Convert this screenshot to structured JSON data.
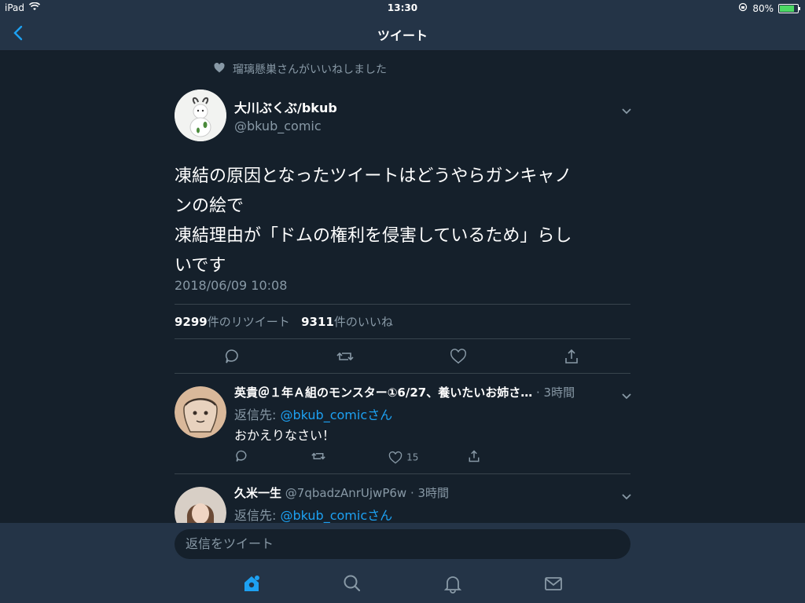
{
  "status_bar": {
    "device": "iPad",
    "time": "13:30",
    "battery": "80%"
  },
  "nav": {
    "title": "ツイート"
  },
  "context": {
    "text": "瑠璃懸巣さんがいいねしました"
  },
  "tweet": {
    "author_name": "大川ぶくぶ/bkub",
    "author_handle": "@bkub_comic",
    "lines": [
      "凍結の原因となったツイートはどうやらガンキャノ",
      "ンの絵で",
      "凍結理由が「ドムの権利を侵害しているため」らし",
      "いです"
    ],
    "timestamp": "2018/06/09 10:08",
    "retweet_count": "9299",
    "retweet_label": "件のリツイート",
    "like_count": "9311",
    "like_label": "件のいいね"
  },
  "replies": [
    {
      "name": "英貴＠１年Ａ組のモンスター①6/27、養いたいお姉さ…",
      "handle": "",
      "time": "· 3時間",
      "to_prefix": "返信先: ",
      "to_link": "@bkub_comicさん",
      "body": "おかえりなさい！",
      "like_count": "15"
    },
    {
      "name": "久米一生",
      "handle": "@7qbadzAnrUjwP6w",
      "time": "· 3時間",
      "to_prefix": "返信先: ",
      "to_link": "@bkub_comicさん"
    }
  ],
  "compose": {
    "placeholder": "返信をツイート"
  },
  "colors": {
    "background": "#15202b",
    "bar": "#243447",
    "accent": "#1da1f2",
    "muted": "#8899a6"
  }
}
